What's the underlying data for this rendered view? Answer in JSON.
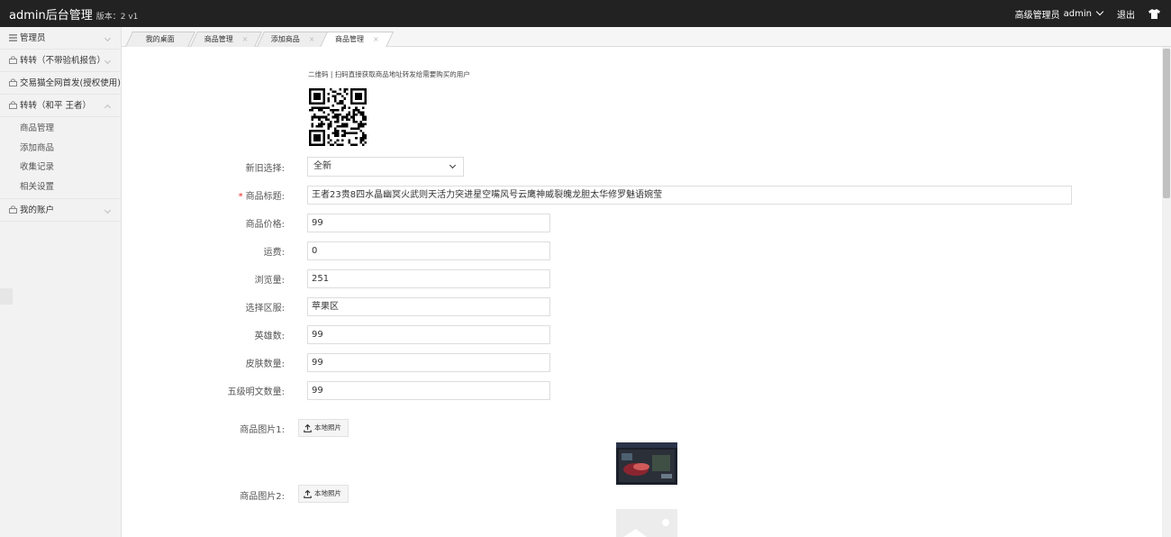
{
  "header": {
    "brand": "admin后台管理",
    "version": "版本：2 v1",
    "role": "高级管理员",
    "user": "admin",
    "logout": "退出",
    "icons": [
      "chevron-down-icon",
      "tshirt-icon"
    ]
  },
  "sidebar": {
    "items": [
      {
        "label": "管理员"
      },
      {
        "label": "转转（不带验机报告）"
      },
      {
        "label": "交易猫全网首发(授权使用)"
      },
      {
        "label": "转转（和平 王者）"
      },
      {
        "label": "我的账户"
      }
    ],
    "subitems": [
      {
        "label": "商品管理"
      },
      {
        "label": "添加商品"
      },
      {
        "label": "收集记录"
      },
      {
        "label": "相关设置"
      }
    ],
    "icons": [
      "list-icon",
      "lock-icon",
      "chevron-down-icon",
      "chevron-up-icon",
      "chevron-left-icon"
    ]
  },
  "tabs": [
    {
      "label": "我的桌面"
    },
    {
      "label": "商品管理"
    },
    {
      "label": "添加商品"
    },
    {
      "label": "商品管理"
    }
  ],
  "form": {
    "qr_caption": "二维码 | 扫码直接获取商品地址转发给需要购买的用户",
    "condition_label": "新旧选择:",
    "condition_value": "全新",
    "title_label": "商品标题:",
    "title_value": "王者23贵8四水晶幽冥火武则天活力突进星空嘴风号云鹰神威裂魄龙胆太华修罗魅语婉莹",
    "price_label": "商品价格:",
    "price_value": "99",
    "shipping_label": "运费:",
    "shipping_value": "0",
    "views_label": "浏览量:",
    "views_value": "251",
    "server_label": "选择区服:",
    "server_value": "苹果区",
    "heroes_label": "英雄数:",
    "heroes_value": "99",
    "skins_label": "皮肤数量:",
    "skins_value": "99",
    "inscriptions_label": "五级明文数量:",
    "inscriptions_value": "99",
    "image1_label": "商品图片1:",
    "image2_label": "商品图片2:",
    "upload_label": "本地照片",
    "icons": [
      "upload-icon",
      "qr-code-icon",
      "image-placeholder-icon"
    ]
  },
  "colors": {
    "header_bg": "#222222",
    "sidebar_bg": "#f2f2f2",
    "required": "#e22222"
  }
}
